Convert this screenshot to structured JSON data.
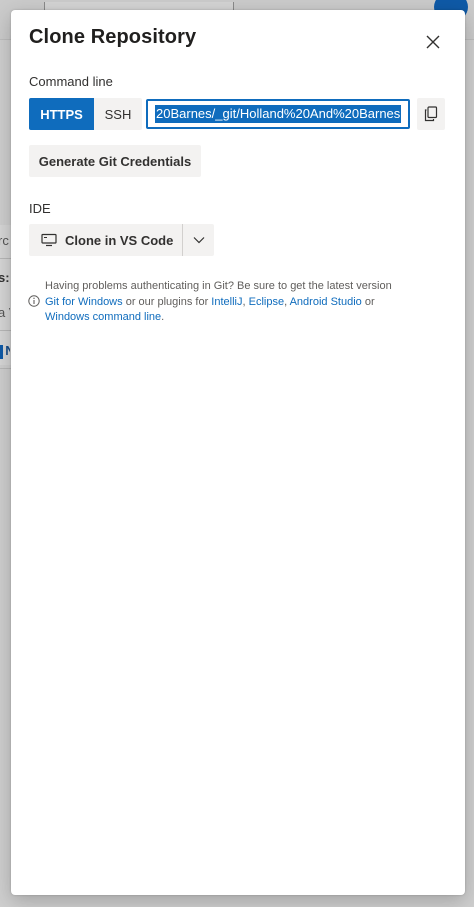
{
  "panel": {
    "title": "Clone Repository"
  },
  "command_line": {
    "label": "Command line",
    "protocols": [
      "HTTPS",
      "SSH"
    ],
    "selected_protocol": "HTTPS",
    "clone_url_visible": "20Barnes/_git/Holland%20And%20Barnes"
  },
  "buttons": {
    "generate_credentials": "Generate Git Credentials",
    "clone_in_vscode": "Clone in VS Code"
  },
  "ide": {
    "label": "IDE"
  },
  "help": {
    "line1": "Having problems authenticating in Git? Be sure to get the latest version",
    "git_for_windows": "Git for Windows",
    "or_our_plugins": " or our plugins for ",
    "intellij": "IntelliJ",
    "comma": ", ",
    "eclipse": "Eclipse",
    "android_studio": "Android Studio",
    "or": " or",
    "windows_command_line": "Windows command line",
    "period": "."
  },
  "background": {
    "left_fragments": [
      "rc",
      "s:",
      "a V",
      "l N"
    ]
  },
  "colors": {
    "accent": "#0f6cbd",
    "button_bg": "#f3f2f1",
    "avatar": "#0f5aa7"
  },
  "icons": {
    "close": "close-icon",
    "copy": "copy-icon",
    "vscode": "computer-monitor-icon",
    "chevron": "chevron-down-icon",
    "info": "info-icon"
  }
}
